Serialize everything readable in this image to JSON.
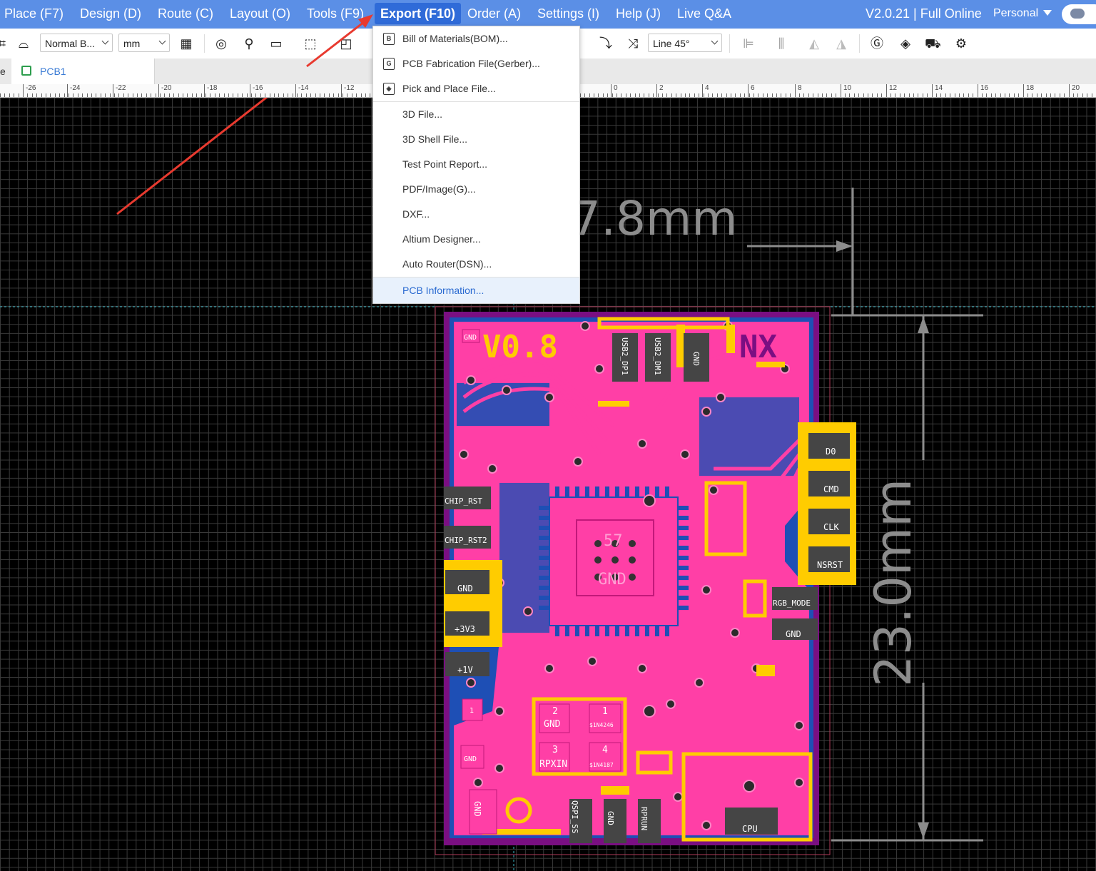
{
  "menubar": {
    "items": [
      "Place (F7)",
      "Design (D)",
      "Route (C)",
      "Layout (O)",
      "Tools (F9)",
      "Export (F10)",
      "Order (A)",
      "Settings (I)",
      "Help (J)",
      "Live Q&A"
    ],
    "version": "V2.0.21 | Full Online",
    "account": "Personal"
  },
  "toolbar": {
    "view_mode": "Normal B...",
    "unit": "mm",
    "route_mode": "Line 45°"
  },
  "tabs": {
    "active": "PCB1"
  },
  "ruler": {
    "labels": [
      "-26",
      "-24",
      "-22",
      "-20",
      "-18",
      "-16",
      "-14",
      "-12",
      "0",
      "2",
      "4",
      "6",
      "8",
      "10",
      "12",
      "14",
      "16",
      "18",
      "20"
    ]
  },
  "export_menu": {
    "items": [
      {
        "label": "Bill of Materials(BOM)...",
        "icon": "bom-icon",
        "glyph": "B"
      },
      {
        "label": "PCB Fabrication File(Gerber)...",
        "icon": "gerber-icon",
        "glyph": "G"
      },
      {
        "label": "Pick and Place File...",
        "icon": "pick-place-icon",
        "glyph": "◈"
      },
      {
        "label": "3D File..."
      },
      {
        "label": "3D Shell File..."
      },
      {
        "label": "Test Point Report..."
      },
      {
        "label": "PDF/Image(G)..."
      },
      {
        "label": "DXF..."
      },
      {
        "label": "Altium Designer..."
      },
      {
        "label": "Auto Router(DSN)..."
      },
      {
        "label": "PCB Information..."
      }
    ]
  },
  "board": {
    "dim_width": "7.8mm",
    "dim_height": "23.0mm",
    "silk": [
      "V0.8",
      "NX"
    ],
    "pads": [
      "GND",
      "USB2_DP1",
      "USB2_DM1",
      "GND",
      "D0",
      "CMD",
      "CLK",
      "NSRST",
      "CHIP_RST",
      "CHIP_RST2",
      "GND",
      "+3V3",
      "+1V",
      "RGB_MODE",
      "GND",
      "57",
      "GND",
      "2",
      "GND",
      "1",
      "$1N4246",
      "3",
      "RPXIN",
      "4",
      "$1N4187",
      "GND",
      "QSPI_SS",
      "GND",
      "RPRUN",
      "CPU",
      "GND",
      "1"
    ]
  },
  "colors": {
    "menubar": "#5b8fe6",
    "accent": "#2a6ad1",
    "board_top": "#ff3fa6",
    "board_bottom": "#1e4fb5",
    "outline": "#7a0f82",
    "silkscreen": "#ffcc00",
    "annotation_arrow": "#e83a2f"
  }
}
